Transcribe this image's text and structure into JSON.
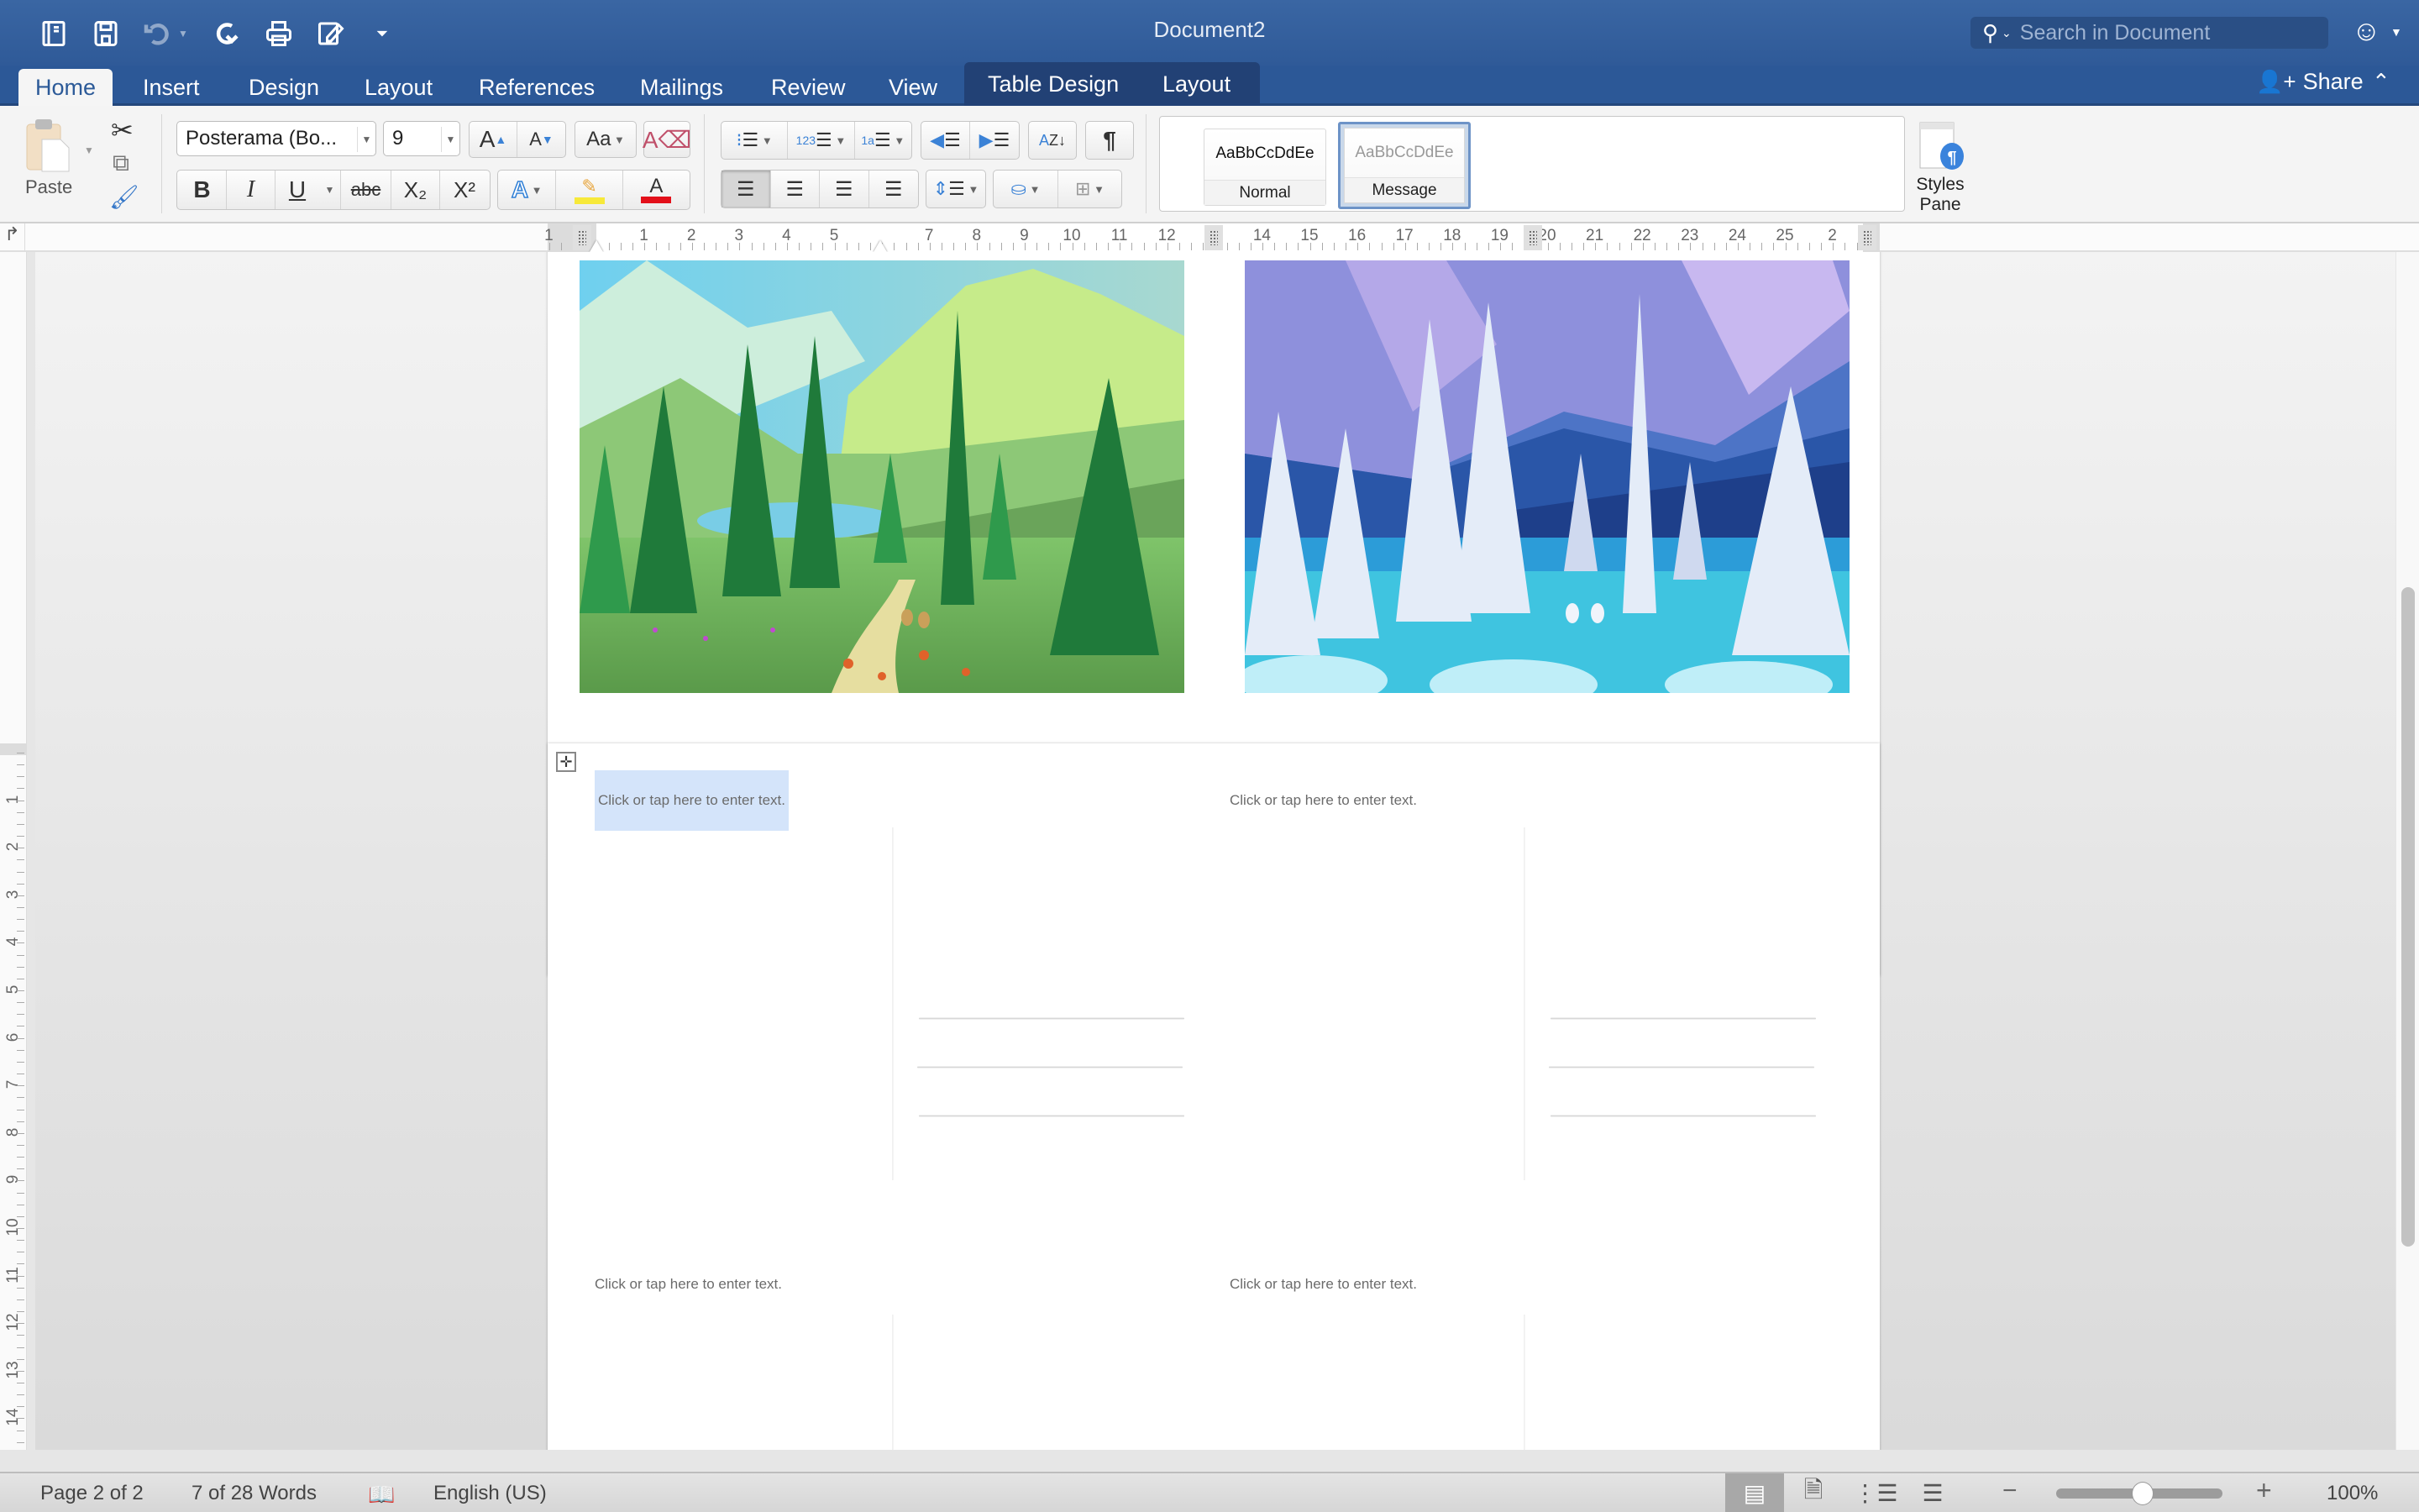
{
  "window": {
    "title": "Document2",
    "search_placeholder": "Search in Document"
  },
  "quick_access": [
    {
      "name": "sidebar-toggle-icon"
    },
    {
      "name": "save-icon"
    },
    {
      "name": "undo-icon"
    },
    {
      "name": "redo-icon"
    },
    {
      "name": "print-icon"
    },
    {
      "name": "edit-document-icon"
    },
    {
      "name": "customize-toolbar-icon"
    }
  ],
  "tabs": [
    {
      "label": "Home",
      "active": true
    },
    {
      "label": "Insert"
    },
    {
      "label": "Design"
    },
    {
      "label": "Layout"
    },
    {
      "label": "References"
    },
    {
      "label": "Mailings"
    },
    {
      "label": "Review"
    },
    {
      "label": "View"
    }
  ],
  "context_tabs": [
    {
      "label": "Table Design"
    },
    {
      "label": "Layout"
    }
  ],
  "share_label": "Share",
  "toolbar": {
    "paste_label": "Paste",
    "font_name": "Posterama (Bo...",
    "font_size": "9",
    "bold": "B",
    "italic": "I",
    "underline": "U",
    "strike": "abc",
    "subscript": "X₂",
    "superscript": "X²",
    "grow_font": "A▴",
    "shrink_font": "A▾",
    "change_case": "Aa",
    "show_marks": "¶",
    "highlight_color": "#f7e93a",
    "font_color": "#e3101a"
  },
  "styles": {
    "cards": [
      {
        "sample": "AaBbCcDdEe",
        "name": "Normal",
        "selected": false
      },
      {
        "sample": "AaBbCcDdEe",
        "name": "Message",
        "selected": true
      }
    ],
    "pane_label_1": "Styles",
    "pane_label_2": "Pane"
  },
  "ruler": {
    "numbers": [
      "1",
      "1",
      "2",
      "3",
      "4",
      "5",
      "7",
      "8",
      "9",
      "10",
      "11",
      "12",
      "14",
      "15",
      "16",
      "17",
      "18",
      "19",
      "20",
      "21",
      "22",
      "23",
      "24",
      "25",
      "2"
    ],
    "vertical_numbers": [
      "1",
      "2",
      "3",
      "4",
      "5",
      "6",
      "7",
      "8",
      "9",
      "10",
      "11",
      "12",
      "13",
      "14"
    ]
  },
  "document": {
    "page1_images": [
      {
        "name": "summer-forest-illustration",
        "description": "Green mountains, pine trees, lake, path, two rabbits, flowers"
      },
      {
        "name": "winter-forest-illustration",
        "description": "Blue-violet mountains, snowy white pine trees, icy lake, two white rabbits"
      }
    ],
    "placeholders": [
      {
        "text": "Click or tap here to enter text.",
        "selected": true
      },
      {
        "text": "Click or tap here to enter text.",
        "selected": false
      },
      {
        "text": "Click or tap here to enter text.",
        "selected": false
      },
      {
        "text": "Click or tap here to enter text.",
        "selected": false
      }
    ]
  },
  "status": {
    "page": "Page 2 of 2",
    "words": "7 of 28 Words",
    "language": "English (US)",
    "zoom_percent": "100%",
    "zoom_value": 100,
    "zoom_min": 10,
    "zoom_max": 500,
    "zoom_slider_fraction": 0.52
  },
  "scroll": {
    "thumb_start_fraction": 0.28,
    "thumb_size_fraction": 0.55
  }
}
